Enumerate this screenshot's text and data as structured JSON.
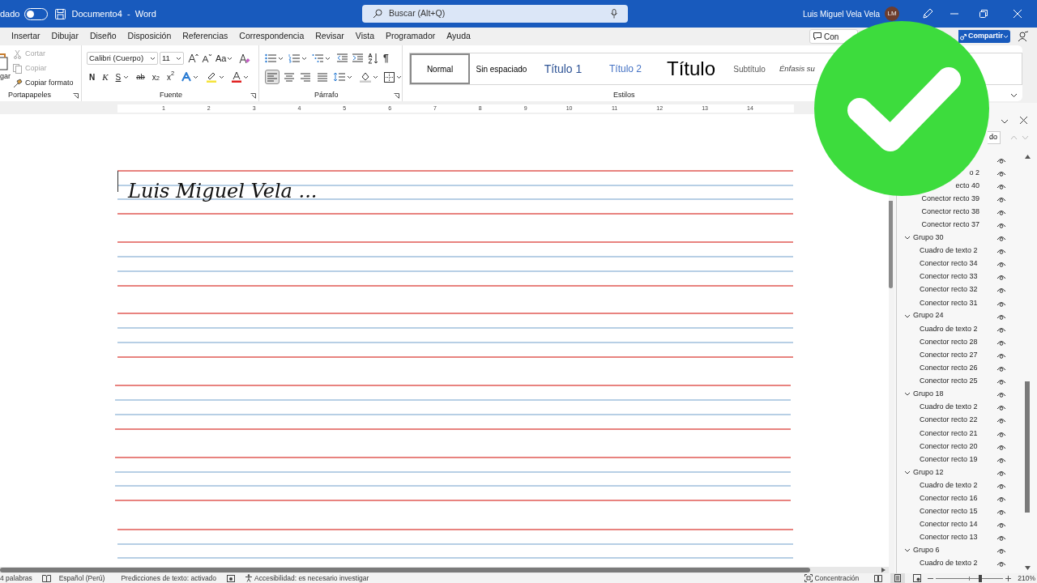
{
  "title_bar": {
    "autosave_label": "dado",
    "autosave_on": false,
    "document_title": "Documento4  -  Word",
    "search_placeholder": "Buscar (Alt+Q)",
    "user_name": "Luis Miguel Vela Vela",
    "avatar_initials": "LM"
  },
  "menu_tabs": [
    "Insertar",
    "Dibujar",
    "Diseño",
    "Disposición",
    "Referencias",
    "Correspondencia",
    "Revisar",
    "Vista",
    "Programador",
    "Ayuda"
  ],
  "header_buttons": {
    "comments": "Con",
    "share": "Compartir"
  },
  "ribbon": {
    "clipboard": {
      "paste_label": "gar",
      "actions": [
        {
          "label": "Cortar",
          "kind": "cut",
          "disabled": true
        },
        {
          "label": "Copiar",
          "kind": "copy",
          "disabled": true
        },
        {
          "label": "Copiar formato",
          "kind": "format_painter",
          "disabled": false
        }
      ],
      "group_label": "Portapapeles"
    },
    "font": {
      "font_name": "Calibri (Cuerpo)",
      "font_size": "11",
      "case_button": "Aa",
      "format_buttons": [
        {
          "kind": "bold",
          "text": "N"
        },
        {
          "kind": "italic",
          "text": "K"
        },
        {
          "kind": "underline",
          "text": "S"
        },
        {
          "kind": "strike",
          "text": "ab"
        },
        {
          "kind": "sub",
          "text": "x$_{2}$"
        },
        {
          "kind": "sup",
          "text": "x$^{2}$"
        }
      ],
      "group_label": "Fuente"
    },
    "paragraph": {
      "pilcrow": "¶",
      "alignments": [
        {
          "kind": "left",
          "selected": true
        },
        {
          "kind": "center",
          "selected": false
        },
        {
          "kind": "right",
          "selected": false
        },
        {
          "kind": "justify",
          "selected": false
        }
      ],
      "group_label": "Párrafo"
    },
    "styles": {
      "items": [
        {
          "label": "Normal",
          "kind": "normal",
          "selected": true
        },
        {
          "label": "Sin espaciado",
          "kind": "no_spacing",
          "selected": false
        },
        {
          "label": "Título 1",
          "kind": "heading1",
          "selected": false
        },
        {
          "label": "Título 2",
          "kind": "heading2",
          "selected": false
        },
        {
          "label": "Título",
          "kind": "title",
          "selected": false
        },
        {
          "label": "Subtítulo",
          "kind": "subtitle",
          "selected": false
        },
        {
          "label": "Énfasis su",
          "kind": "emphasis",
          "selected": false
        }
      ],
      "group_label": "Estilos"
    }
  },
  "ruler": {
    "numbers": [
      "1",
      "2",
      "3",
      "4",
      "5",
      "6",
      "7",
      "8",
      "9",
      "10",
      "11",
      "12",
      "13",
      "14"
    ]
  },
  "document": {
    "text": "Luis Miguel Vela ..."
  },
  "selection_pane": {
    "show_all_button": "do",
    "groups": [
      {
        "children": [
          "o 2",
          "ecto 40",
          "Conector recto 39",
          "Conector recto 38",
          "Conector recto 37"
        ]
      },
      {
        "label": "Grupo 30",
        "expanded": true,
        "children": [
          "Cuadro de texto 2",
          "Conector recto 34",
          "Conector recto 33",
          "Conector recto 32",
          "Conector recto 31"
        ]
      },
      {
        "label": "Grupo 24",
        "expanded": true,
        "children": [
          "Cuadro de texto 2",
          "Conector recto 28",
          "Conector recto 27",
          "Conector recto 26",
          "Conector recto 25"
        ]
      },
      {
        "label": "Grupo 18",
        "expanded": true,
        "children": [
          "Cuadro de texto 2",
          "Conector recto 22",
          "Conector recto 21",
          "Conector recto 20",
          "Conector recto 19"
        ]
      },
      {
        "label": "Grupo 12",
        "expanded": true,
        "children": [
          "Cuadro de texto 2",
          "Conector recto 16",
          "Conector recto 15",
          "Conector recto 14",
          "Conector recto 13"
        ]
      },
      {
        "label": "Grupo 6",
        "expanded": true,
        "children": [
          "Cuadro de texto 2"
        ]
      }
    ]
  },
  "status_bar": {
    "word_count": "4 palabras",
    "language": "Español (Perú)",
    "text_predictions": "Predicciones de texto: activado",
    "accessibility": "Accesibilidad: es necesario investigar",
    "focus": "Concentración",
    "zoom_slider": {
      "level": 0.66
    },
    "zoom": "210%"
  }
}
